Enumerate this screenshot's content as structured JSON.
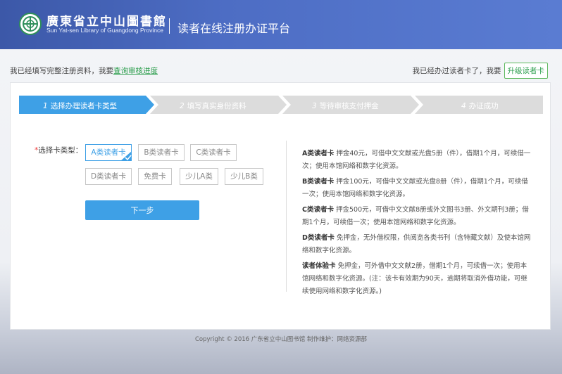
{
  "header": {
    "logo_cn": "廣東省立中山圖書館",
    "logo_en": "Sun Yat-sen Library of Guangdong Province",
    "platform_title": "读者在线注册办证平台",
    "emblem_icon": "library-emblem-icon"
  },
  "topbar": {
    "left_text": "我已经填写完整注册资料，我要",
    "left_link": "查询审核进度",
    "right_text": "我已经办过读者卡了，我要",
    "upgrade_button": "升级读者卡"
  },
  "steps": [
    {
      "num": "1",
      "label": "选择办理读者卡类型",
      "active": true
    },
    {
      "num": "2",
      "label": "填写真实身份资料",
      "active": false
    },
    {
      "num": "3",
      "label": "等待审核支付押金",
      "active": false
    },
    {
      "num": "4",
      "label": "办证成功",
      "active": false
    }
  ],
  "form": {
    "required_mark": "*",
    "label": "选择卡类型：",
    "options": [
      "A类读者卡",
      "B类读者卡",
      "C类读者卡",
      "D类读者卡",
      "免费卡",
      "少儿A类",
      "少儿B类"
    ],
    "selected": "A类读者卡",
    "next_button": "下一步"
  },
  "descriptions": [
    {
      "name": "A类读者卡",
      "text": " 押金40元，可借中文文献或光盘5册（件），借期1个月，可续借一次；使用本馆网络和数字化资源。"
    },
    {
      "name": "B类读者卡",
      "text": " 押金100元，可借中文文献或光盘8册（件），借期1个月，可续借一次；使用本馆网络和数字化资源。"
    },
    {
      "name": "C类读者卡",
      "text": " 押金500元，可借中文文献8册或外文图书3册、外文期刊3册；借期1个月，可续借一次；使用本馆网络和数字化资源。"
    },
    {
      "name": "D类读者卡",
      "text": " 免押金，无外借权限，供阅览各类书刊（含特藏文献）及使本馆网络和数字化资源。"
    },
    {
      "name": "读者体验卡",
      "text": " 免押金，可外借中文文献2册，借期1个月，可续借一次；使用本馆网络和数字化资源。(注：该卡有效期为90天，逾期将取消外借功能，可继续使用网络和数字化资源。)"
    }
  ],
  "footer": {
    "text": "Copyright © 2016 广东省立中山图书馆    制作维护：网络资源部"
  },
  "colors": {
    "header_blue": "#4d6dc4",
    "accent_blue": "#3ea0e6",
    "step_inactive": "#dcdcdc",
    "link_green": "#2a9d4b"
  }
}
